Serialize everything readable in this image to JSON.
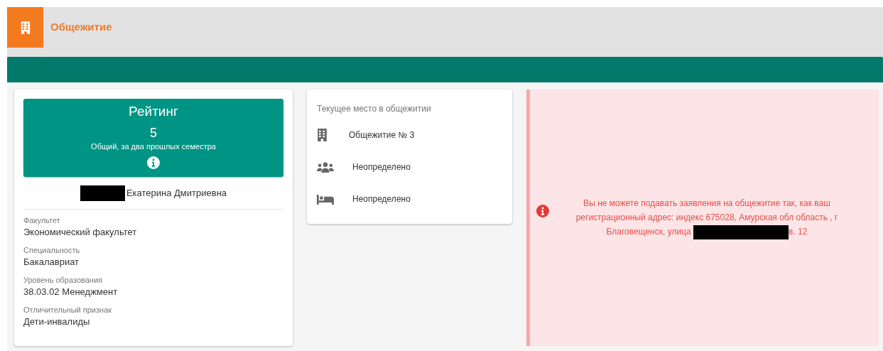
{
  "header": {
    "title": "Общежитие"
  },
  "rating": {
    "title": "Рейтинг",
    "value": "5",
    "caption": "Общий, за два прошлых семестра"
  },
  "student": {
    "name_redacted": true,
    "name": "Екатерина Дмитриевна"
  },
  "fields": [
    {
      "label": "Факультет",
      "value": "Экономический факультет"
    },
    {
      "label": "Специальность",
      "value": "Бакалавриат"
    },
    {
      "label": "Уровень образования",
      "value": "38.03.02 Менеджмент"
    },
    {
      "label": "Отличительный признак",
      "value": "Дети-инвалиды"
    }
  ],
  "current_place": {
    "title": "Текущее место в общежитии",
    "items": [
      {
        "kind": "building",
        "text": "Общежитие № 3"
      },
      {
        "kind": "people",
        "text": "Неопределено"
      },
      {
        "kind": "bed",
        "text": "Неопределено"
      }
    ]
  },
  "alert": {
    "text_before": "Вы не можете подавать заявления на общежитие так, как ваш регистрационный адрес: индекс 675028, Амурская обл область , г Благовещенск, улица",
    "redacted": true,
    "text_after": "в. 12"
  }
}
